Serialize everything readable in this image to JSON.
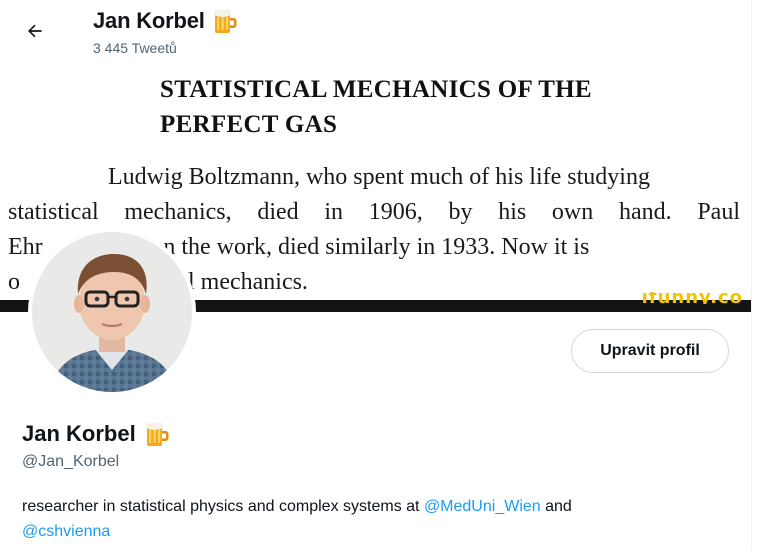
{
  "header": {
    "name": "Jan Korbel",
    "tweet_count": "3 445 Tweetů",
    "back_icon": "arrow-left-icon"
  },
  "banner": {
    "title_line1": "STATISTICAL MECHANICS OF THE",
    "title_line2": "PERFECT GAS",
    "paragraph_lines": [
      "Ludwig Boltzmann, who spent much of his life studying",
      "statistical mechanics, died in 1906, by his own hand. Paul",
      "Ehr          ving on the work, died similarly in 1933. Now it is",
      "o              statistical mechanics."
    ],
    "watermark": "ifunny.co"
  },
  "profile": {
    "edit_button": "Upravit profil",
    "name": "Jan Korbel",
    "handle": "@Jan_Korbel",
    "bio_text": "researcher in statistical physics and complex systems at ",
    "bio_link1": "@MedUni_Wien",
    "bio_mid": " and",
    "bio_link2": "@cshvienna"
  },
  "colors": {
    "accent": "#1d9bf0",
    "secondary_text": "#536471",
    "border": "#cfd9de"
  }
}
